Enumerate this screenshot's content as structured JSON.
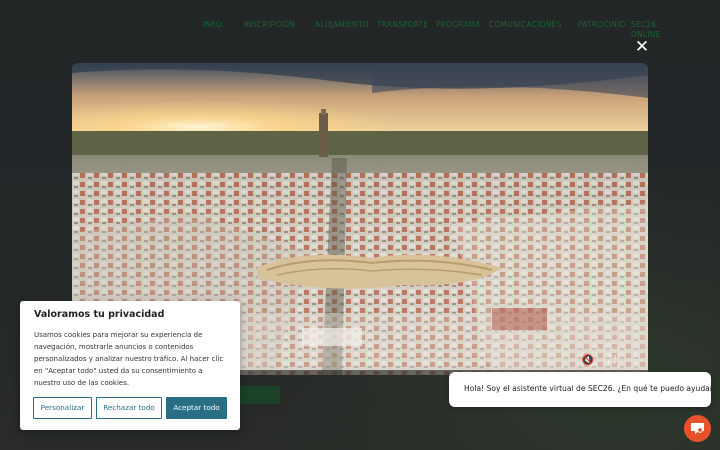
{
  "nav": {
    "items": [
      "INFO",
      "INSCRIPCIÓN",
      "ALOJAMIENTO",
      "TRANSPORTE",
      "PROGRAMA",
      "COMUNICACIONES",
      "PATROCINIO"
    ],
    "last_line1": "SEC26",
    "last_line2": "ONLINE"
  },
  "modal": {
    "close_symbol": "✕"
  },
  "video": {
    "controls": {
      "mute": "🔇",
      "fullscreen": "⛶",
      "more": "⋮"
    }
  },
  "cookie": {
    "title": "Valoramos tu privacidad",
    "text": "Usamos cookies para mejorar su experiencia de navegación, mostrarle anuncios o contenidos personalizados y analizar nuestro tráfico. Al hacer clic en \"Aceptar todo\" usted da su consentimiento a nuestro uso de las cookies.",
    "customize": "Personalizar",
    "reject": "Rechazar todo",
    "accept": "Aceptar todo"
  },
  "chat": {
    "message": "Hola! Soy el asistente virtual de SEC26. ¿En qué te puedo ayudar?",
    "accent": "#e8522b"
  }
}
